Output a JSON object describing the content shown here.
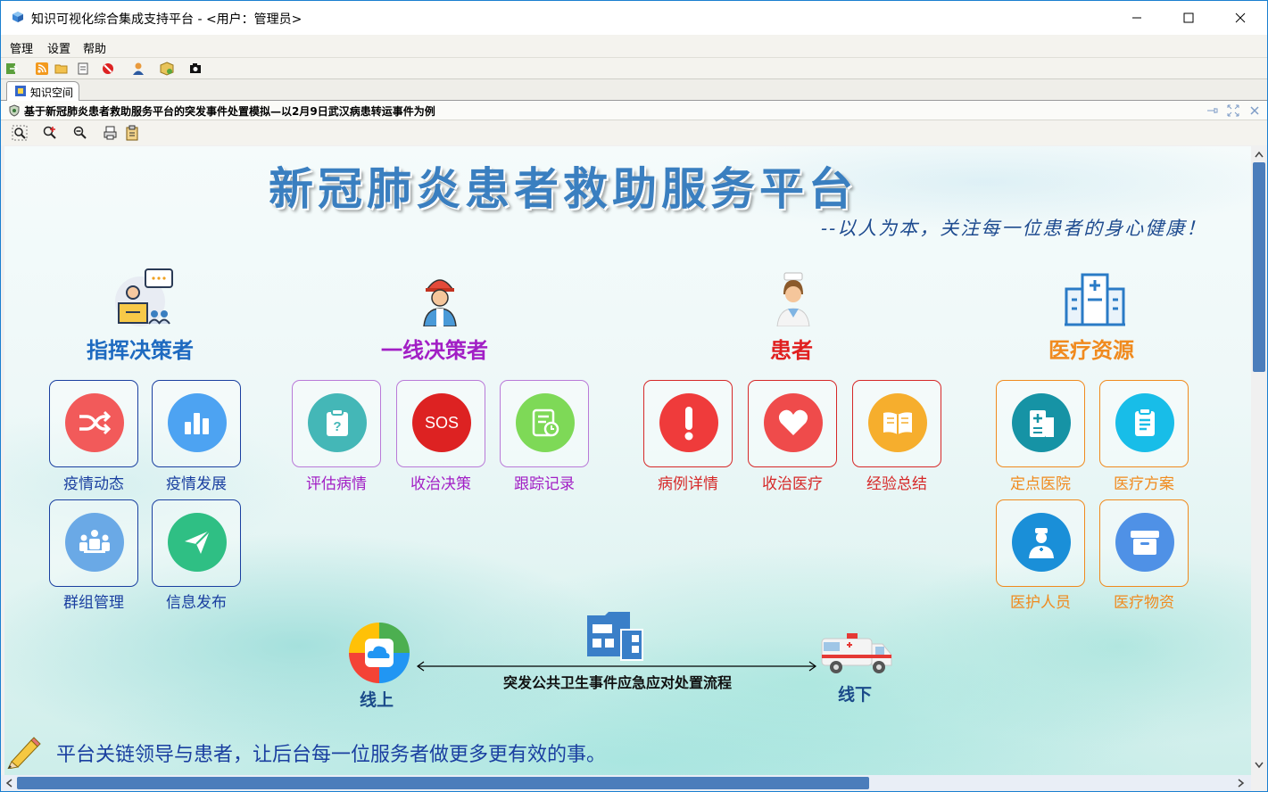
{
  "window": {
    "title": "知识可视化综合集成支持平台 - <用户：管理员>"
  },
  "menu": [
    "管理",
    "设置",
    "帮助"
  ],
  "tab": {
    "label": "知识空间"
  },
  "doc": {
    "title": "基于新冠肺炎患者救助服务平台的突发事件处置模拟—以2月9日武汉病患转运事件为例"
  },
  "main": {
    "title": "新冠肺炎患者救助服务平台",
    "slogan": "--以人为本，关注每一位患者的身心健康！",
    "flow_text": "突发公共卫生事件应急应对处置流程",
    "online": "线上",
    "offline": "线下",
    "footer": "平台关链领导与患者，让后台每一位服务者做更多更有效的事。"
  },
  "sections": {
    "commander": {
      "title": "指挥决策者",
      "color": "#1e6ac0",
      "items": [
        {
          "label": "疫情动态",
          "icon": "shuffle-icon",
          "color": "#f25a5a"
        },
        {
          "label": "疫情发展",
          "icon": "bar-chart-icon",
          "color": "#4da3f2"
        },
        {
          "label": "群组管理",
          "icon": "group-meeting-icon",
          "color": "#6aa9e6"
        },
        {
          "label": "信息发布",
          "icon": "paper-plane-icon",
          "color": "#2fbf84"
        }
      ]
    },
    "frontline": {
      "title": "一线决策者",
      "color": "#a21fc5",
      "items": [
        {
          "label": "评估病情",
          "icon": "clipboard-question-icon",
          "color": "#44b7b7"
        },
        {
          "label": "收治决策",
          "icon": "sos-icon",
          "color": "#dd2222"
        },
        {
          "label": "跟踪记录",
          "icon": "document-clock-icon",
          "color": "#7ed957"
        }
      ]
    },
    "patient": {
      "title": "患者",
      "color": "#e02020",
      "items": [
        {
          "label": "病例详情",
          "icon": "exclamation-icon",
          "color": "#ef3b3b"
        },
        {
          "label": "收治医疗",
          "icon": "heart-icon",
          "color": "#ef4b4b"
        },
        {
          "label": "经验总结",
          "icon": "book-icon",
          "color": "#f6ae2d"
        }
      ]
    },
    "resources": {
      "title": "医疗资源",
      "color": "#f08a1e",
      "items": [
        {
          "label": "定点医院",
          "icon": "hospital-building-icon",
          "color": "#1693a5"
        },
        {
          "label": "医疗方案",
          "icon": "notepad-icon",
          "color": "#18bde8"
        },
        {
          "label": "医护人员",
          "icon": "doctor-icon",
          "color": "#1a8fd8"
        },
        {
          "label": "医疗物资",
          "icon": "supply-box-icon",
          "color": "#4f91e6"
        }
      ]
    }
  }
}
